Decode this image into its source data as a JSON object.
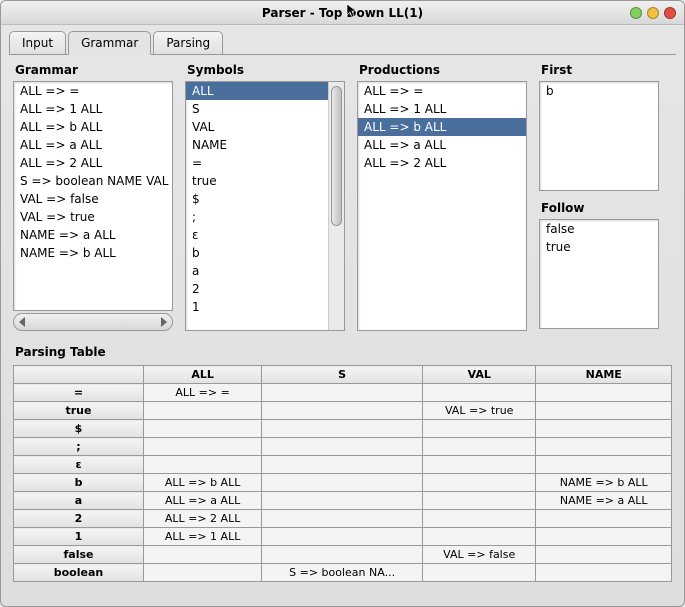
{
  "window": {
    "title": "Parser - Top Down LL(1)"
  },
  "tabs": [
    {
      "label": "Input"
    },
    {
      "label": "Grammar"
    },
    {
      "label": "Parsing"
    }
  ],
  "active_tab": 1,
  "panels": {
    "grammar": {
      "title": "Grammar",
      "items": [
        "ALL => =",
        "ALL => 1 ALL",
        "ALL => b ALL",
        "ALL => a ALL",
        "ALL => 2 ALL",
        "S => boolean NAME VAL",
        "VAL => false",
        "VAL => true",
        "NAME => a ALL",
        "NAME => b ALL"
      ]
    },
    "symbols": {
      "title": "Symbols",
      "items": [
        "ALL",
        "S",
        "VAL",
        "NAME",
        "=",
        "true",
        "$",
        ";",
        "ε",
        "b",
        "a",
        "2",
        "1"
      ],
      "selected_index": 0
    },
    "productions": {
      "title": "Productions",
      "items": [
        "ALL => =",
        "ALL => 1 ALL",
        "ALL => b ALL",
        "ALL => a ALL",
        "ALL => 2 ALL"
      ],
      "selected_index": 2
    },
    "first": {
      "title": "First",
      "items": [
        "b"
      ]
    },
    "follow": {
      "title": "Follow",
      "items": [
        "false",
        "true"
      ]
    }
  },
  "parsing_table": {
    "title": "Parsing Table",
    "columns": [
      "ALL",
      "S",
      "VAL",
      "NAME"
    ],
    "rows": [
      {
        "header": "=",
        "cells": [
          "ALL => =",
          "",
          "",
          ""
        ]
      },
      {
        "header": "true",
        "cells": [
          "",
          "",
          "VAL => true",
          ""
        ]
      },
      {
        "header": "$",
        "cells": [
          "",
          "",
          "",
          ""
        ]
      },
      {
        "header": ";",
        "cells": [
          "",
          "",
          "",
          ""
        ]
      },
      {
        "header": "ε",
        "cells": [
          "",
          "",
          "",
          ""
        ]
      },
      {
        "header": "b",
        "cells": [
          "ALL => b ALL",
          "",
          "",
          "NAME => b ALL"
        ]
      },
      {
        "header": "a",
        "cells": [
          "ALL => a ALL",
          "",
          "",
          "NAME => a ALL"
        ]
      },
      {
        "header": "2",
        "cells": [
          "ALL => 2 ALL",
          "",
          "",
          ""
        ]
      },
      {
        "header": "1",
        "cells": [
          "ALL => 1 ALL",
          "",
          "",
          ""
        ]
      },
      {
        "header": "false",
        "cells": [
          "",
          "",
          "VAL => false",
          ""
        ]
      },
      {
        "header": "boolean",
        "cells": [
          "",
          "S => boolean NA...",
          "",
          ""
        ]
      }
    ]
  }
}
